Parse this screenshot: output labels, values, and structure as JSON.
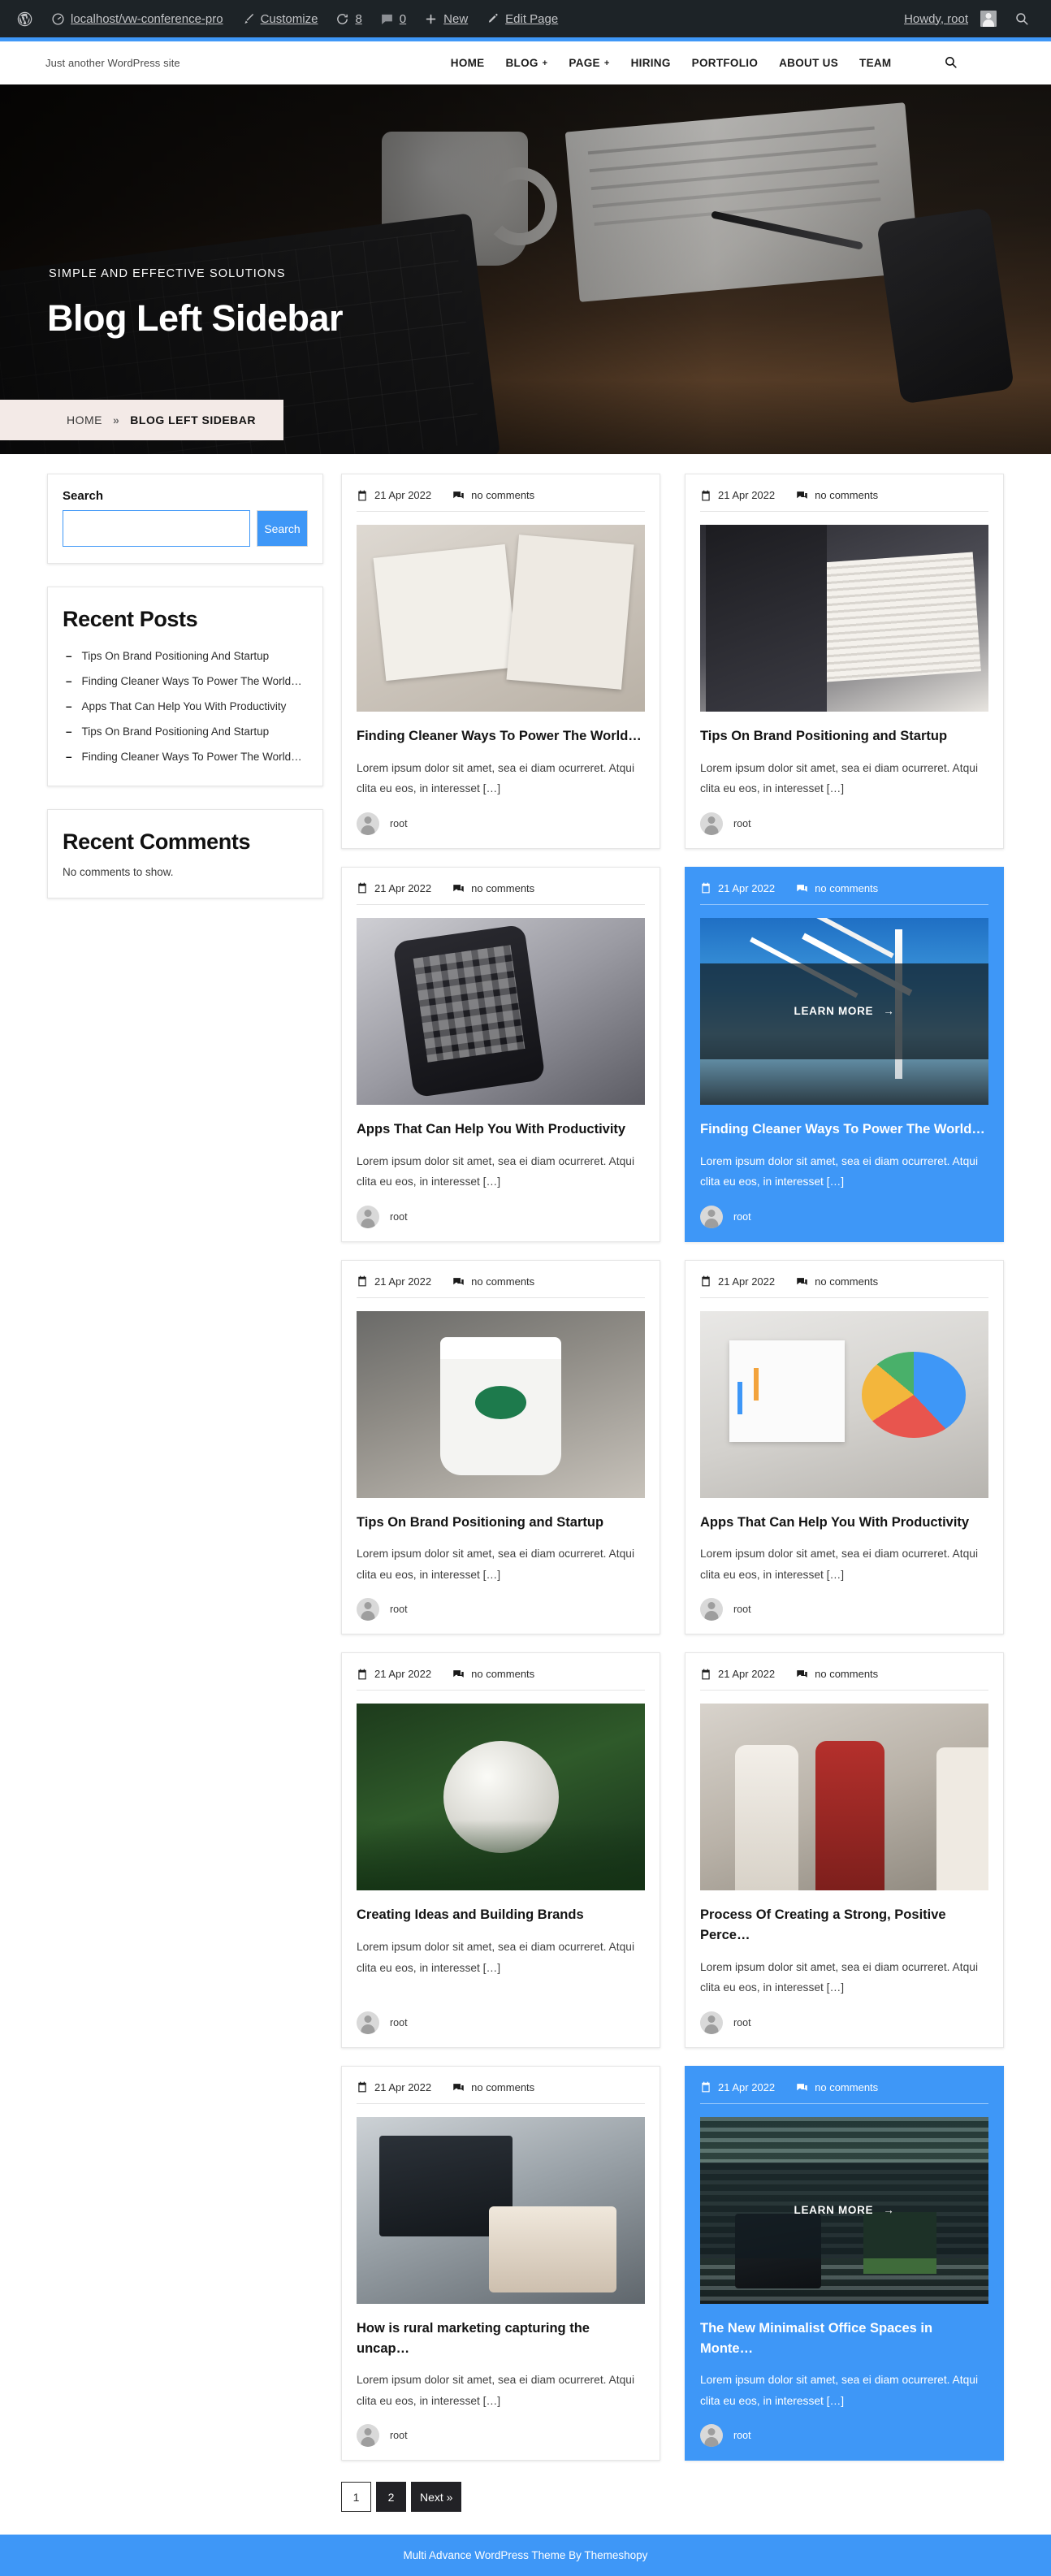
{
  "adminbar": {
    "wp_logo": "wordpress-logo-icon",
    "site_name": "localhost/vw-conference-pro",
    "customize": "Customize",
    "updates_count": "8",
    "comments_count": "0",
    "new": "New",
    "edit_page": "Edit Page",
    "howdy": "Howdy, root",
    "search": "search-icon"
  },
  "header": {
    "tagline": "Just another WordPress site",
    "nav": [
      {
        "label": "HOME",
        "has_submenu": false
      },
      {
        "label": "BLOG",
        "has_submenu": true
      },
      {
        "label": "PAGE",
        "has_submenu": true
      },
      {
        "label": "HIRING",
        "has_submenu": false
      },
      {
        "label": "PORTFOLIO",
        "has_submenu": false
      },
      {
        "label": "ABOUT US",
        "has_submenu": false
      },
      {
        "label": "TEAM",
        "has_submenu": false
      }
    ],
    "submenu_marker": "+",
    "search_icon": "search-icon"
  },
  "hero": {
    "eyebrow": "SIMPLE AND EFFECTIVE SOLUTIONS",
    "title": "Blog Left Sidebar",
    "breadcrumb": {
      "home": "HOME",
      "separator": "»",
      "current": "BLOG LEFT SIDEBAR"
    }
  },
  "sidebar": {
    "search_widget": {
      "label": "Search",
      "input_value": "",
      "placeholder": "",
      "button": "Search"
    },
    "recent_posts": {
      "title": "Recent Posts",
      "bullet": "–",
      "items": [
        "Tips On Brand Positioning And Startup",
        "Finding Cleaner Ways To Power The World…",
        "Apps That Can Help You With Productivity",
        "Tips On Brand Positioning And Startup",
        "Finding Cleaner Ways To Power The World…"
      ]
    },
    "recent_comments": {
      "title": "Recent Comments",
      "empty_text": "No comments to show."
    }
  },
  "posts": {
    "learn_more_label": "LEARN MORE",
    "learn_more_arrow": "→",
    "items": [
      {
        "date": "21 Apr 2022",
        "comments": "no comments",
        "title": "Finding Cleaner Ways To Power The World…",
        "excerpt": "Lorem ipsum dolor sit amet, sea ei diam ocurreret. Atqui clita eu eos, in interesset […]",
        "author": "root",
        "image": "tax-documents-calculator-photo",
        "hovered": false
      },
      {
        "date": "21 Apr 2022",
        "comments": "no comments",
        "title": "Tips On Brand Positioning and Startup",
        "excerpt": "Lorem ipsum dolor sit amet, sea ei diam ocurreret. Atqui clita eu eos, in interesset […]",
        "author": "root",
        "image": "man-reading-business-newspaper-photo",
        "hovered": false
      },
      {
        "date": "21 Apr 2022",
        "comments": "no comments",
        "title": "Apps That Can Help You With Productivity",
        "excerpt": "Lorem ipsum dolor sit amet, sea ei diam ocurreret. Atqui clita eu eos, in interesset […]",
        "author": "root",
        "image": "hand-holding-smartphone-apps-photo",
        "hovered": false
      },
      {
        "date": "21 Apr 2022",
        "comments": "no comments",
        "title": "Finding Cleaner Ways To Power The World…",
        "excerpt": "Lorem ipsum dolor sit amet, sea ei diam ocurreret. Atqui clita eu eos, in interesset […]",
        "author": "root",
        "image": "wind-turbine-blue-sky-photo",
        "hovered": true
      },
      {
        "date": "21 Apr 2022",
        "comments": "no comments",
        "title": "Tips On Brand Positioning and Startup",
        "excerpt": "Lorem ipsum dolor sit amet, sea ei diam ocurreret. Atqui clita eu eos, in interesset […]",
        "author": "root",
        "image": "coffee-cup-starbucks-photo",
        "hovered": false
      },
      {
        "date": "21 Apr 2022",
        "comments": "no comments",
        "title": "Apps That Can Help You With Productivity",
        "excerpt": "Lorem ipsum dolor sit amet, sea ei diam ocurreret. Atqui clita eu eos, in interesset […]",
        "author": "root",
        "image": "laptop-charts-dashboard-photo",
        "hovered": false
      },
      {
        "date": "21 Apr 2022",
        "comments": "no comments",
        "title": "Creating Ideas and Building Brands",
        "excerpt": "Lorem ipsum dolor sit amet, sea ei diam ocurreret. Atqui clita eu eos, in interesset […]",
        "author": "root",
        "image": "spalding-ball-leaves-photo",
        "hovered": false
      },
      {
        "date": "21 Apr 2022",
        "comments": "no comments",
        "title": "Process Of Creating a Strong, Positive Perce…",
        "excerpt": "Lorem ipsum dolor sit amet, sea ei diam ocurreret. Atqui clita eu eos, in interesset […]",
        "author": "root",
        "image": "three-women-walking-photo",
        "hovered": false
      },
      {
        "date": "21 Apr 2022",
        "comments": "no comments",
        "title": "How is rural marketing capturing the uncap…",
        "excerpt": "Lorem ipsum dolor sit amet, sea ei diam ocurreret. Atqui clita eu eos, in interesset […]",
        "author": "root",
        "image": "person-working-desk-monitor-photo",
        "hovered": false
      },
      {
        "date": "21 Apr 2022",
        "comments": "no comments",
        "title": "The New Minimalist Office Spaces in Monte…",
        "excerpt": "Lorem ipsum dolor sit amet, sea ei diam ocurreret. Atqui clita eu eos, in interesset […]",
        "author": "root",
        "image": "minimalist-office-blinds-plant-photo",
        "hovered": true
      }
    ]
  },
  "pagination": [
    {
      "label": "1",
      "current": true
    },
    {
      "label": "2",
      "current": false
    },
    {
      "label": "Next »",
      "current": false
    }
  ],
  "footer": {
    "text": "Multi Advance WordPress Theme By Themeshopy"
  },
  "colors": {
    "accent": "#3e97f7",
    "adminbar": "#1d2327",
    "breadcrumb_bg": "#f3eae7",
    "pagination_dark": "#222226"
  }
}
